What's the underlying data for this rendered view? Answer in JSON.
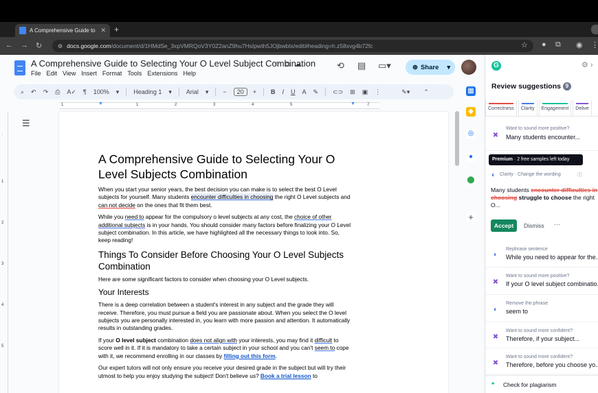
{
  "browser": {
    "tab_title": "A Comprehensive Guide to S",
    "url_host": "docs.google.com",
    "url_path": "/document/d/1HMdSe_3xpVMRQoV3Y0Z2anZ9hu7HsIpwth5JOjbwbts/edit#heading=h.z58xvg4b72fc"
  },
  "docs": {
    "title": "A Comprehensive Guide to Selecting Your O Level Subject Combination",
    "menu": [
      "File",
      "Edit",
      "View",
      "Insert",
      "Format",
      "Tools",
      "Extensions",
      "Help"
    ],
    "share_label": "Share",
    "toolbar": {
      "zoom": "100%",
      "style": "Heading 1",
      "font": "Arial",
      "font_size": "20"
    },
    "ruler_numbers": [
      "1",
      "1",
      "2",
      "3",
      "4",
      "5",
      "6",
      "7"
    ]
  },
  "document": {
    "h1": "A Comprehensive Guide to Selecting Your O Level Subjects Combination",
    "p1_a": "When you start your senior years, the best decision you can make is to select the best O Level subjects for yourself. Many students ",
    "p1_b": "encounter difficulties in choosing",
    "p1_c": " the right O Level subjects and ",
    "p1_d": "can not decide",
    "p1_e": " on the ones that fit them best.",
    "p2_a": "While you ",
    "p2_b": "need to",
    "p2_c": " appear for the compulsory o level subjects at any cost, the ",
    "p2_d": "choice of other additional subjects",
    "p2_e": " is in your hands. You should consider many factors before finalizing your O Level subject combination. In this article, we have highlighted all the necessary things to look into. So, keep reading!",
    "h2": "Things To Consider Before Choosing Your O Level Subjects Combination",
    "p3": "Here are some significant factors to consider when choosing your O Level subjects.",
    "h3": "Your Interests",
    "p4": "There is a deep correlation between a student's interest in any subject and the grade they will receive. Therefore, you must pursue a field you are passionate about. When you select the O level subjects you are personally interested in, you learn with more passion and attention. It automatically results in outstanding grades.",
    "p5_a": "If your ",
    "p5_b": "O level subject",
    "p5_c": " combination ",
    "p5_d": "does not align with",
    "p5_e": " your interests, you may find it ",
    "p5_f": "difficult",
    "p5_g": " to score well in it. If it is mandatory to take a certain subject in your school and you can't ",
    "p5_h": "seem to",
    "p5_i": " cope with it, we recommend enrolling in our classes by ",
    "p5_link": "filling out this form",
    "p5_j": ".",
    "p6_a": "Our expert tutors will not only ensure you receive your desired grade in the subject but will try their utmost to help you enjoy studying the subject! Don't believe us? ",
    "p6_link": "Book a trial lesson",
    "p6_b": " to"
  },
  "grammarly": {
    "title": "Review suggestions",
    "count": "9",
    "tabs": [
      "Correctness",
      "Clarity",
      "Engagement",
      "Delive"
    ],
    "cards": [
      {
        "small": "Want to sound more positive?",
        "main": "Many students encounter..."
      },
      {
        "small": "Rephrase sentence",
        "main": "While you need to appear for the..."
      },
      {
        "small": "Want to sound more positive?",
        "main": "If your O level subject combinatio..."
      },
      {
        "small": "Remove the phrase",
        "main": "seem to"
      },
      {
        "small": "Want to sound more confident?",
        "main": "Therefore, if your subject..."
      },
      {
        "small": "Want to sound more confident?",
        "main": "Therefore, before you choose yo..."
      }
    ],
    "premium_bold": "Premium",
    "premium_rest": " · 2 free samples left today",
    "open": {
      "label": "Clarity · Change the wording",
      "pre": "Many students ",
      "strike": "encounter difficulties in choosing",
      "ins": "struggle to choose",
      "post": " the right O..."
    },
    "accept": "Accept",
    "dismiss": "Dismiss",
    "plagiarism": "Check for plagiarism"
  },
  "colors": {
    "grammarly_green": "#15c39a",
    "accept_green": "#15875f",
    "share_bg": "#c2e7ff",
    "docs_blue": "#4285f4"
  }
}
